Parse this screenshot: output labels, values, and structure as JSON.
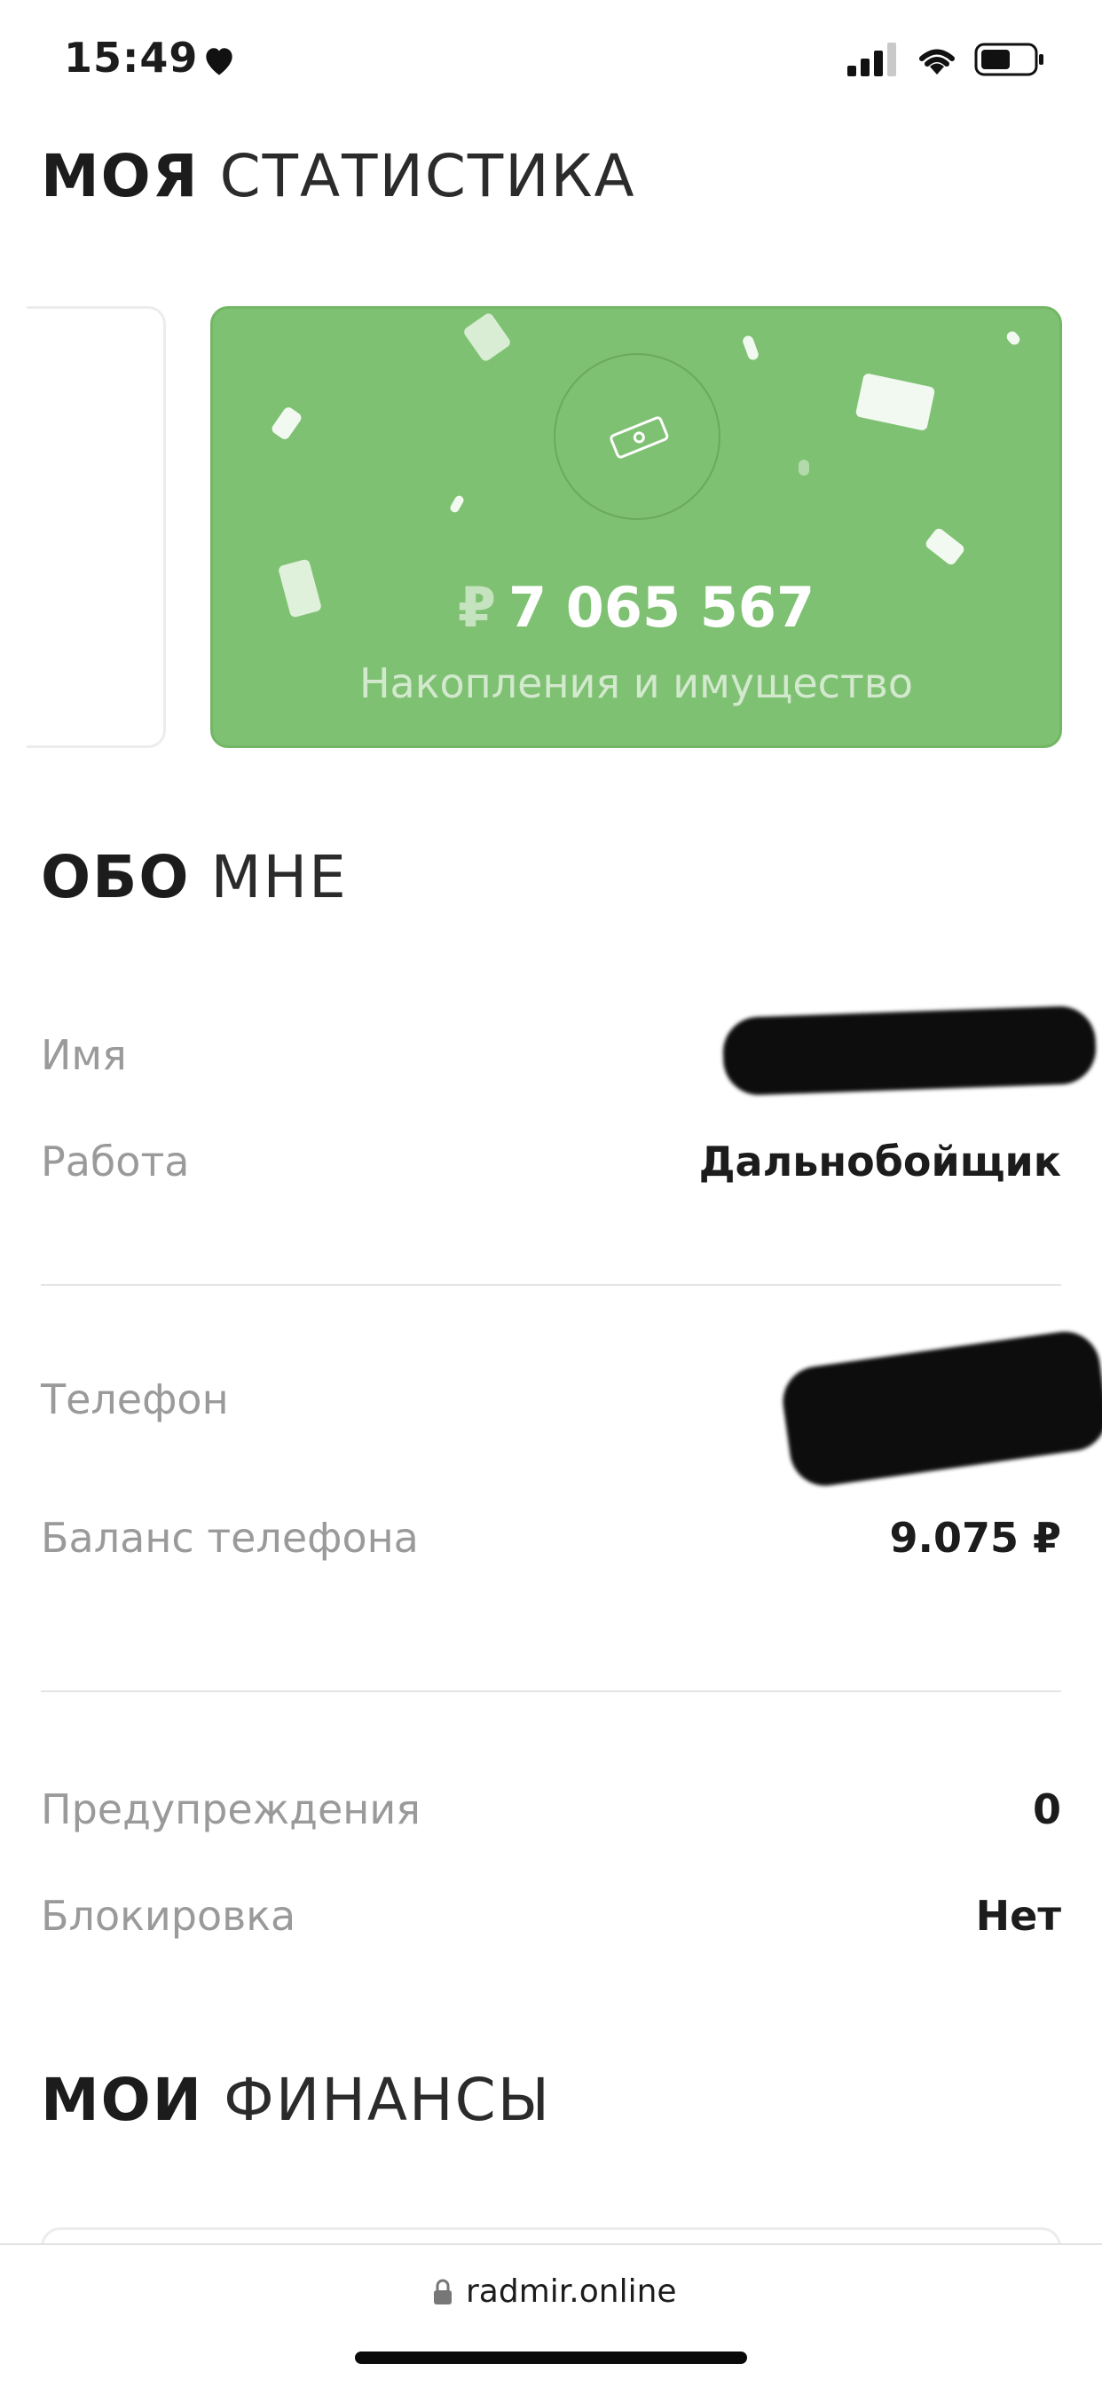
{
  "status_bar": {
    "time": "15:49"
  },
  "stats_section": {
    "title_bold": "МОЯ",
    "title_light": "СТАТИСТИКА",
    "card": {
      "currency": "₽",
      "amount": "7 065 567",
      "label": "Накопления и имущество",
      "color": "#7fc172",
      "icon": "money-bill-icon"
    }
  },
  "about_section": {
    "title_bold": "ОБО",
    "title_light": "МНЕ",
    "rows": [
      {
        "label": "Имя",
        "value": ""
      },
      {
        "label": "Работа",
        "value": "Дальнобойщик"
      },
      {
        "label": "Телефон",
        "value": ""
      },
      {
        "label": "Баланс телефона",
        "value": "9.075 ₽"
      },
      {
        "label": "Предупреждения",
        "value": "0"
      },
      {
        "label": "Блокировка",
        "value": "Нет"
      }
    ]
  },
  "finance_section": {
    "title_bold": "МОИ",
    "title_light": "ФИНАНСЫ"
  },
  "browser": {
    "url": "radmir.online"
  }
}
